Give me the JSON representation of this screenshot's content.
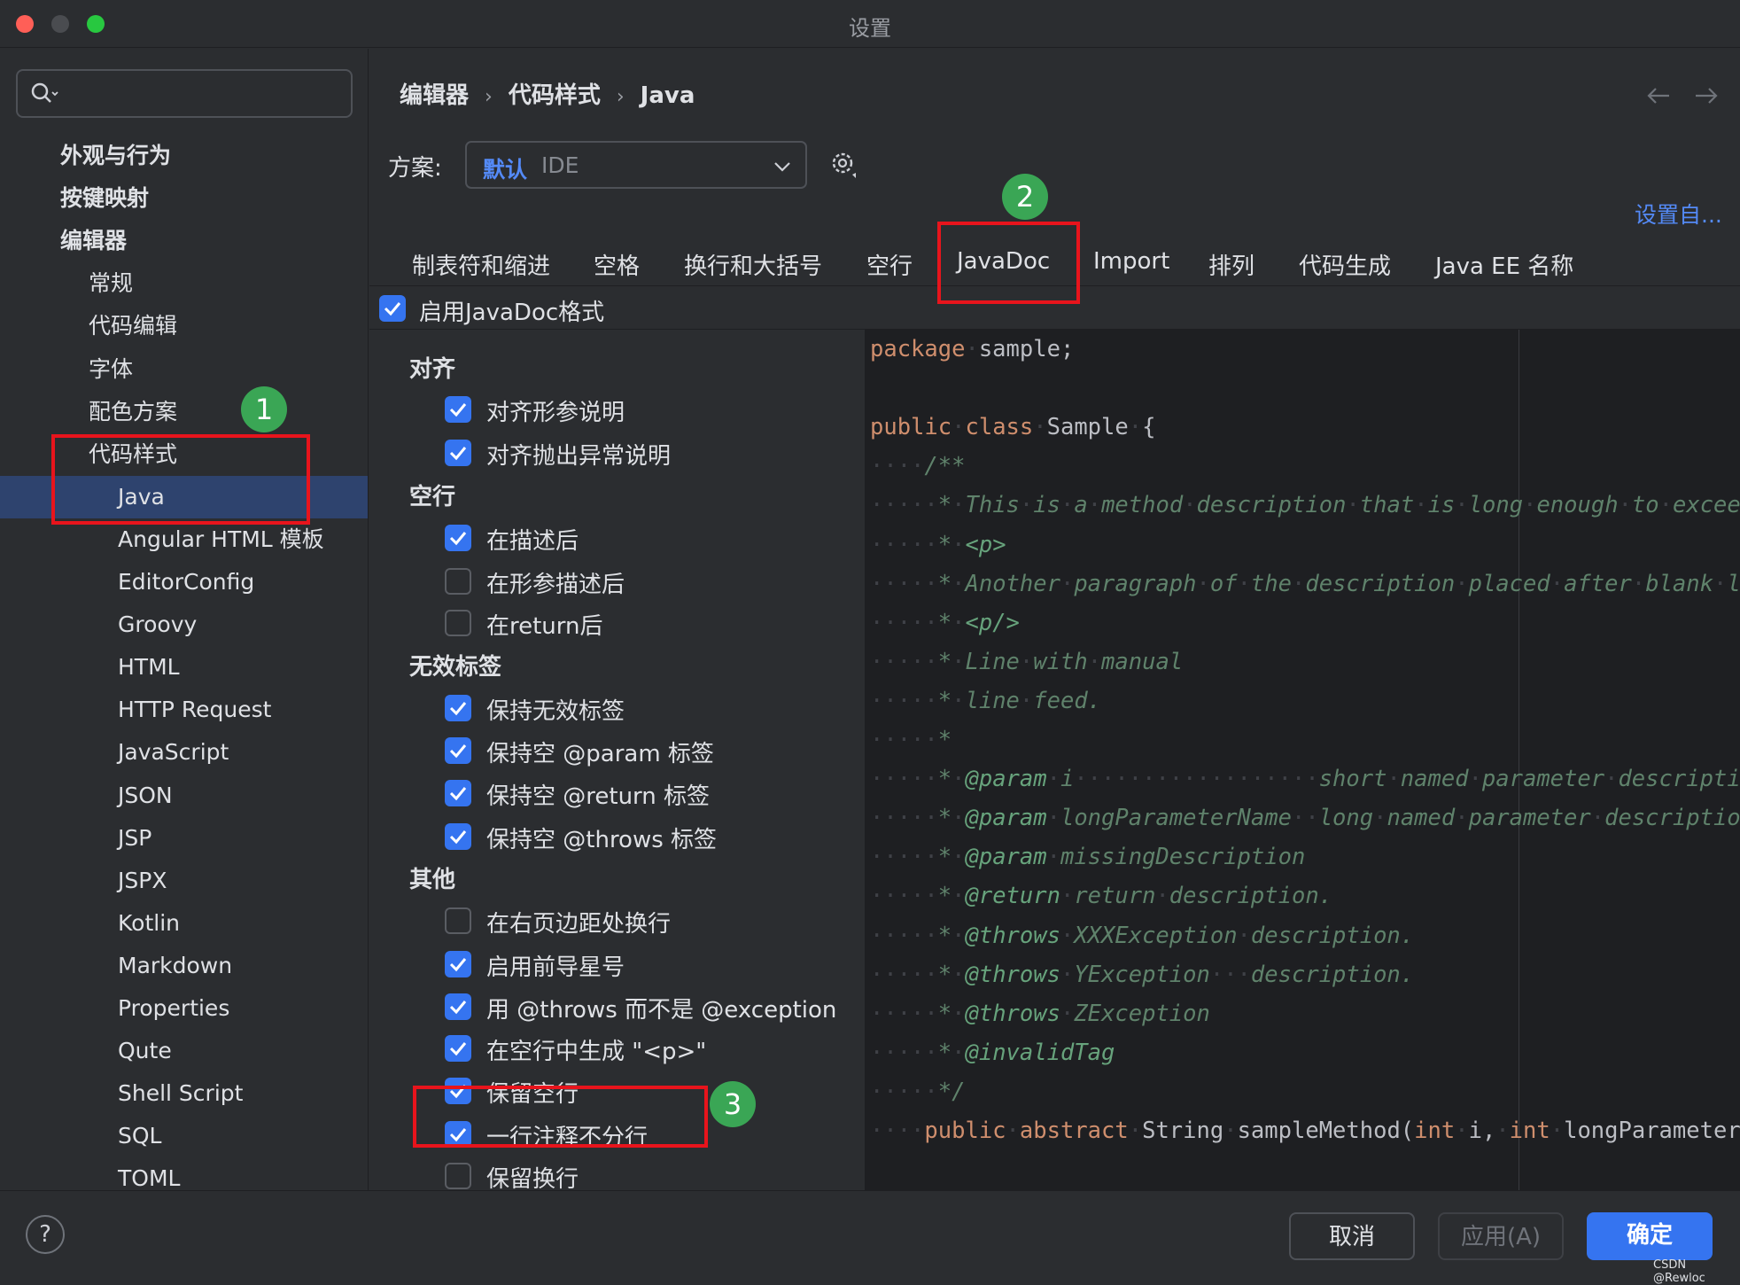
{
  "window": {
    "title": "设置",
    "traffic_lights": [
      "#ff5f57",
      "#4a4c50",
      "#28c840"
    ]
  },
  "search": {
    "placeholder": "",
    "icon": "search-icon"
  },
  "sidebar": {
    "items": [
      {
        "label": "外观与行为",
        "level": 0,
        "arrow": "right",
        "bold": true
      },
      {
        "label": "按键映射",
        "level": 0,
        "arrow": "",
        "bold": true
      },
      {
        "label": "编辑器",
        "level": 0,
        "arrow": "down",
        "bold": true
      },
      {
        "label": "常规",
        "level": 1,
        "arrow": "right"
      },
      {
        "label": "代码编辑",
        "level": 1,
        "arrow": ""
      },
      {
        "label": "字体",
        "level": 1,
        "arrow": ""
      },
      {
        "label": "配色方案",
        "level": 1,
        "arrow": "right"
      },
      {
        "label": "代码样式",
        "level": 1,
        "arrow": "down"
      },
      {
        "label": "Java",
        "level": 2,
        "arrow": "",
        "selected": true
      },
      {
        "label": "Angular HTML 模板",
        "level": 2,
        "arrow": ""
      },
      {
        "label": "EditorConfig",
        "level": 2,
        "arrow": ""
      },
      {
        "label": "Groovy",
        "level": 2,
        "arrow": ""
      },
      {
        "label": "HTML",
        "level": 2,
        "arrow": ""
      },
      {
        "label": "HTTP Request",
        "level": 2,
        "arrow": ""
      },
      {
        "label": "JavaScript",
        "level": 2,
        "arrow": ""
      },
      {
        "label": "JSON",
        "level": 2,
        "arrow": ""
      },
      {
        "label": "JSP",
        "level": 2,
        "arrow": ""
      },
      {
        "label": "JSPX",
        "level": 2,
        "arrow": ""
      },
      {
        "label": "Kotlin",
        "level": 2,
        "arrow": ""
      },
      {
        "label": "Markdown",
        "level": 2,
        "arrow": ""
      },
      {
        "label": "Properties",
        "level": 2,
        "arrow": ""
      },
      {
        "label": "Qute",
        "level": 2,
        "arrow": ""
      },
      {
        "label": "Shell Script",
        "level": 2,
        "arrow": ""
      },
      {
        "label": "SQL",
        "level": 2,
        "arrow": "right"
      },
      {
        "label": "TOML",
        "level": 2,
        "arrow": ""
      }
    ]
  },
  "breadcrumb": [
    "编辑器",
    "代码样式",
    "Java"
  ],
  "scheme": {
    "label": "方案:",
    "value_bold": "默认",
    "value": "IDE"
  },
  "set_from": "设置自...",
  "tabs": [
    {
      "label": "制表符和缩进"
    },
    {
      "label": "空格"
    },
    {
      "label": "换行和大括号"
    },
    {
      "label": "空行"
    },
    {
      "label": "JavaDoc",
      "active": true
    },
    {
      "label": "Import"
    },
    {
      "label": "排列"
    },
    {
      "label": "代码生成"
    },
    {
      "label": "Java EE 名称"
    }
  ],
  "enable_javadoc": {
    "label": "启用JavaDoc格式",
    "checked": true
  },
  "options": [
    {
      "group": "对齐"
    },
    {
      "label": "对齐形参说明",
      "checked": true
    },
    {
      "label": "对齐抛出异常说明",
      "checked": true
    },
    {
      "group": "空行"
    },
    {
      "label": "在描述后",
      "checked": true
    },
    {
      "label": "在形参描述后",
      "checked": false
    },
    {
      "label": "在return后",
      "checked": false
    },
    {
      "group": "无效标签"
    },
    {
      "label": "保持无效标签",
      "checked": true
    },
    {
      "label": "保持空 @param 标签",
      "checked": true
    },
    {
      "label": "保持空 @return 标签",
      "checked": true
    },
    {
      "label": "保持空 @throws 标签",
      "checked": true
    },
    {
      "group": "其他"
    },
    {
      "label": "在右页边距处换行",
      "checked": false
    },
    {
      "label": "启用前导星号",
      "checked": true
    },
    {
      "label": "用 @throws 而不是 @exception",
      "checked": true
    },
    {
      "label": "在空行中生成 \"<p>\"",
      "checked": true
    },
    {
      "label": "保留空行",
      "checked": true
    },
    {
      "label": "一行注释不分行",
      "checked": true
    },
    {
      "label": "保留换行",
      "checked": false
    }
  ],
  "code": [
    [
      [
        "package",
        "kw"
      ],
      [
        " ",
        "ws"
      ],
      [
        "sample;",
        ""
      ]
    ],
    [],
    [
      [
        "public",
        "kw"
      ],
      [
        " ",
        "ws"
      ],
      [
        "class",
        "kw"
      ],
      [
        " ",
        "ws"
      ],
      [
        "Sample",
        ""
      ],
      [
        " ",
        "ws"
      ],
      [
        "{",
        ""
      ]
    ],
    [
      [
        "    ",
        "ws"
      ],
      [
        "/**",
        "cm"
      ]
    ],
    [
      [
        "     ",
        "ws"
      ],
      [
        "* This is a method description that is long enough to exceed right margin.",
        "cm"
      ]
    ],
    [
      [
        "     ",
        "ws"
      ],
      [
        "* ",
        "cm"
      ],
      [
        "<p>",
        "tg"
      ]
    ],
    [
      [
        "     ",
        "ws"
      ],
      [
        "* Another paragraph of the description placed after blank line.",
        "cm"
      ]
    ],
    [
      [
        "     ",
        "ws"
      ],
      [
        "* ",
        "cm"
      ],
      [
        "<p/>",
        "tg"
      ]
    ],
    [
      [
        "     ",
        "ws"
      ],
      [
        "* Line with manual",
        "cm"
      ]
    ],
    [
      [
        "     ",
        "ws"
      ],
      [
        "* line feed.",
        "cm"
      ]
    ],
    [
      [
        "     ",
        "ws"
      ],
      [
        "*",
        "cm"
      ]
    ],
    [
      [
        "     ",
        "ws"
      ],
      [
        "* ",
        "cm"
      ],
      [
        "@param",
        "tg"
      ],
      [
        " i                  short named parameter description",
        "cm"
      ]
    ],
    [
      [
        "     ",
        "ws"
      ],
      [
        "* ",
        "cm"
      ],
      [
        "@param",
        "tg"
      ],
      [
        " longParameterName  long named parameter description",
        "cm"
      ]
    ],
    [
      [
        "     ",
        "ws"
      ],
      [
        "* ",
        "cm"
      ],
      [
        "@param",
        "tg"
      ],
      [
        " missingDescription",
        "cm"
      ]
    ],
    [
      [
        "     ",
        "ws"
      ],
      [
        "* ",
        "cm"
      ],
      [
        "@return",
        "tg"
      ],
      [
        " return description.",
        "cm"
      ]
    ],
    [
      [
        "     ",
        "ws"
      ],
      [
        "* ",
        "cm"
      ],
      [
        "@throws",
        "tg"
      ],
      [
        " XXXException description.",
        "cm"
      ]
    ],
    [
      [
        "     ",
        "ws"
      ],
      [
        "* ",
        "cm"
      ],
      [
        "@throws",
        "tg"
      ],
      [
        " YException   description.",
        "cm"
      ]
    ],
    [
      [
        "     ",
        "ws"
      ],
      [
        "* ",
        "cm"
      ],
      [
        "@throws",
        "tg"
      ],
      [
        " ZException",
        "cm"
      ]
    ],
    [
      [
        "     ",
        "ws"
      ],
      [
        "* ",
        "cm"
      ],
      [
        "@invalidTag",
        "tg"
      ]
    ],
    [
      [
        "     ",
        "ws"
      ],
      [
        "*/",
        "cm"
      ]
    ],
    [
      [
        "    ",
        "ws"
      ],
      [
        "public",
        "kw"
      ],
      [
        " ",
        "ws"
      ],
      [
        "abstract",
        "kw"
      ],
      [
        " ",
        "ws"
      ],
      [
        "String",
        ""
      ],
      [
        " ",
        "ws"
      ],
      [
        "sampleMethod(",
        ""
      ],
      [
        "int",
        "kw"
      ],
      [
        " ",
        "ws"
      ],
      [
        "i,",
        ""
      ],
      [
        " ",
        "ws"
      ],
      [
        "int",
        "kw"
      ],
      [
        " ",
        "ws"
      ],
      [
        "longParameterName",
        ""
      ]
    ]
  ],
  "footer": {
    "cancel": "取消",
    "apply": "应用(A)",
    "ok": "确定",
    "help": "?",
    "watermark": "CSDN @Rewloc"
  },
  "annotations": [
    "1",
    "2",
    "3"
  ],
  "colors": {
    "accent": "#3574f0",
    "link": "#548af7",
    "selection": "#2e436e",
    "annotation_box": "#e8141c",
    "annotation_badge": "#3aa655"
  }
}
